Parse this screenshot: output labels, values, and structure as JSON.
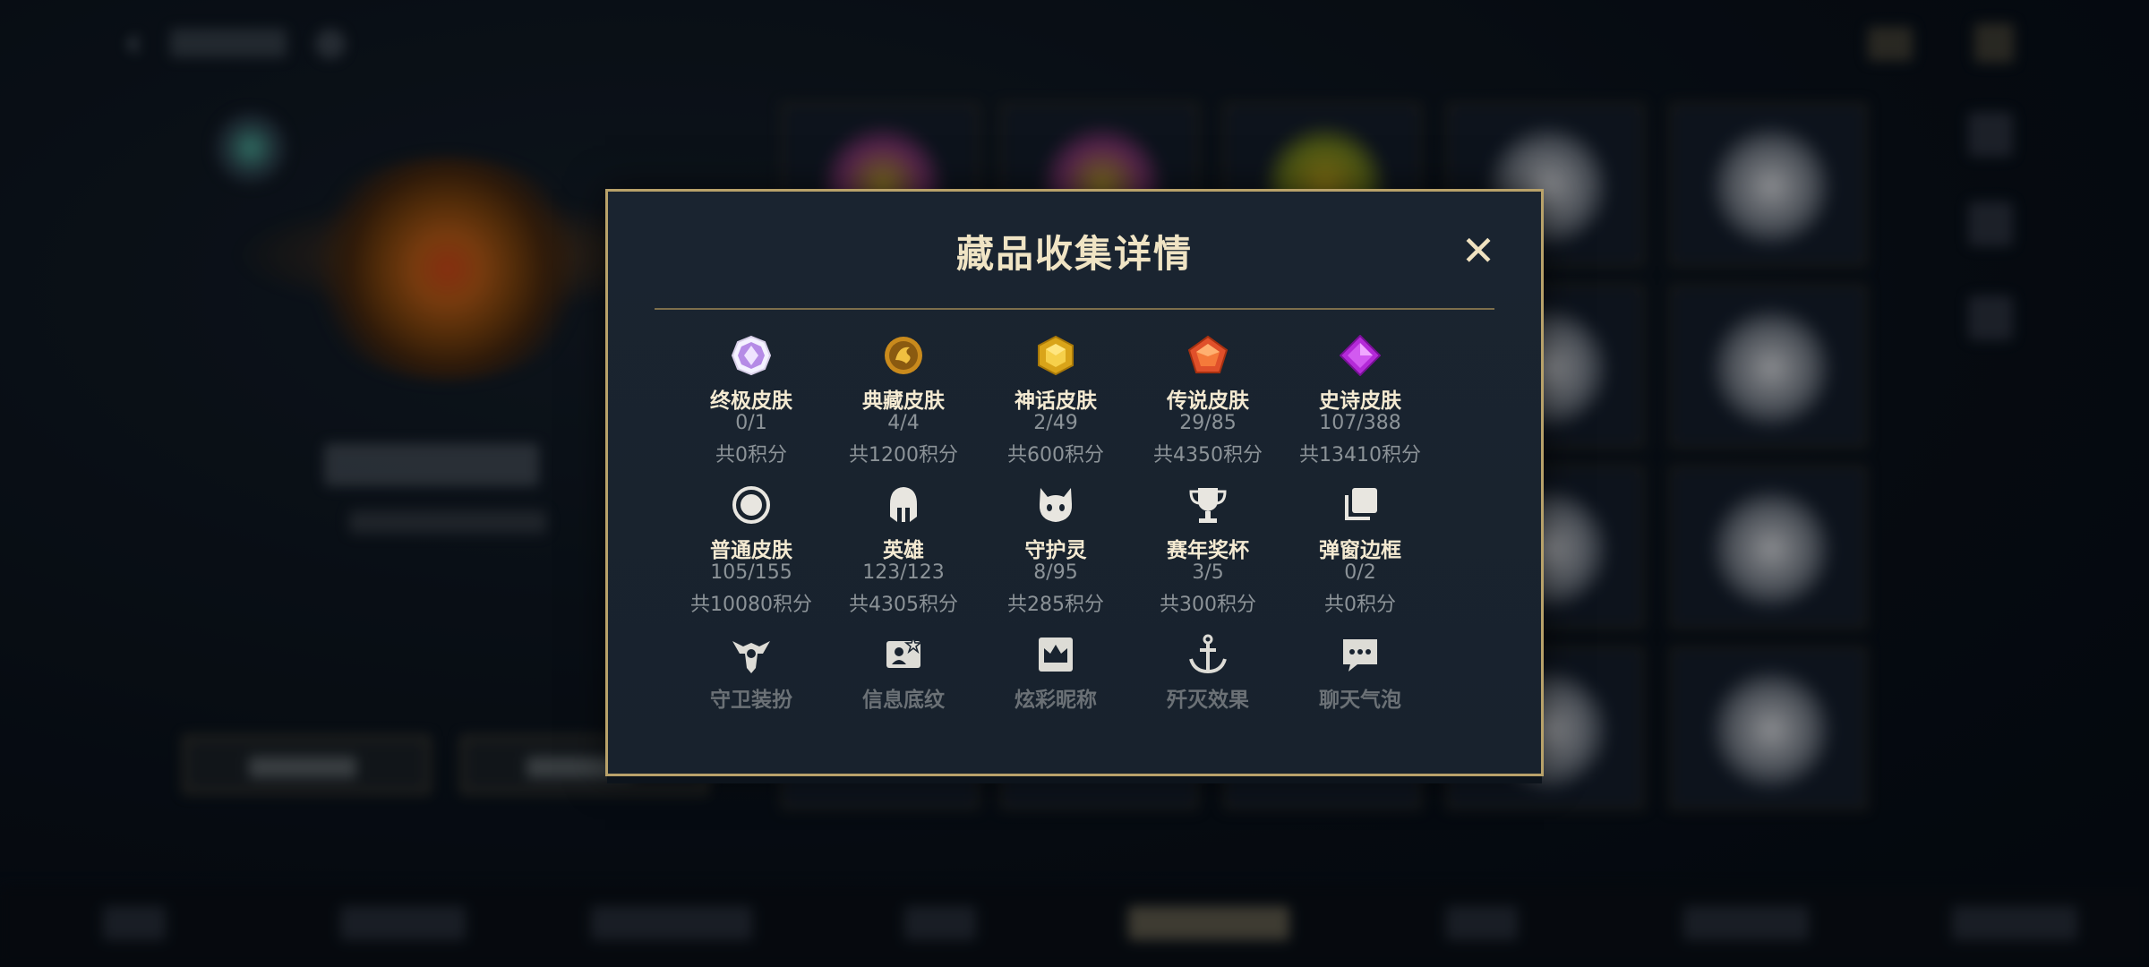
{
  "modal": {
    "title": "藏品收集详情",
    "close_symbol": "✕",
    "categories": [
      {
        "label": "终极皮肤",
        "count": "0/1",
        "points": "共0积分",
        "icon": "ultimate-gem-icon"
      },
      {
        "label": "典藏皮肤",
        "count": "4/4",
        "points": "共1200积分",
        "icon": "dragon-medallion-icon"
      },
      {
        "label": "神话皮肤",
        "count": "2/49",
        "points": "共600积分",
        "icon": "gold-hexagon-icon"
      },
      {
        "label": "传说皮肤",
        "count": "29/85",
        "points": "共4350积分",
        "icon": "orange-pentagon-icon"
      },
      {
        "label": "史诗皮肤",
        "count": "107/388",
        "points": "共13410积分",
        "icon": "purple-diamond-icon"
      },
      {
        "label": "普通皮肤",
        "count": "105/155",
        "points": "共10080积分",
        "icon": "ring-icon"
      },
      {
        "label": "英雄",
        "count": "123/123",
        "points": "共4305积分",
        "icon": "helmet-icon"
      },
      {
        "label": "守护灵",
        "count": "8/95",
        "points": "共285积分",
        "icon": "guardian-spirit-icon"
      },
      {
        "label": "赛年奖杯",
        "count": "3/5",
        "points": "共300积分",
        "icon": "trophy-icon"
      },
      {
        "label": "弹窗边框",
        "count": "0/2",
        "points": "共0积分",
        "icon": "stacked-frames-icon"
      },
      {
        "label": "守卫装扮",
        "icon": "ward-icon"
      },
      {
        "label": "信息底纹",
        "icon": "profile-card-icon"
      },
      {
        "label": "炫彩昵称",
        "icon": "crown-badge-icon"
      },
      {
        "label": "歼灭效果",
        "icon": "anchor-icon"
      },
      {
        "label": "聊天气泡",
        "icon": "chat-bubble-icon"
      }
    ]
  },
  "colors": {
    "modal_border": "#b9a26a",
    "title": "#f0e4c4",
    "label": "#f4ead2",
    "secondary_text": "#8c9398"
  }
}
